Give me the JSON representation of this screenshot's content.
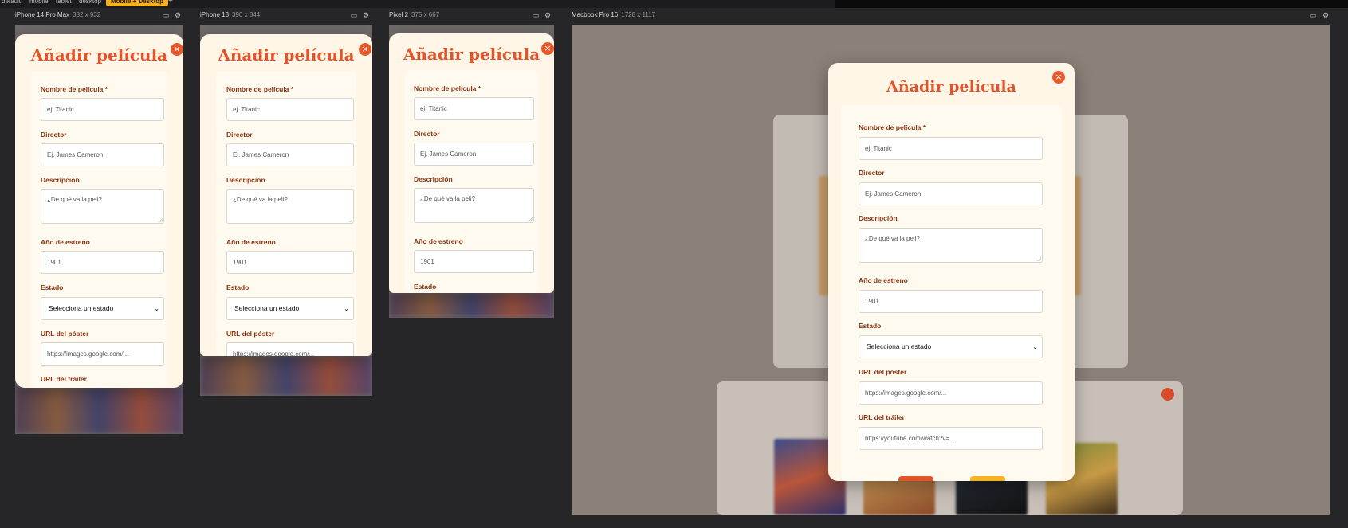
{
  "toolbar": {
    "tabs": [
      "default",
      "mobile",
      "tablet",
      "desktop",
      "Mobile + Desktop"
    ],
    "active_tab": "Mobile + Desktop",
    "add_icon": "+"
  },
  "devices": [
    {
      "name": "iPhone 14 Pro Max",
      "dims": "382 x 932"
    },
    {
      "name": "iPhone 13",
      "dims": "390 x 844"
    },
    {
      "name": "Pixel 2",
      "dims": "375 x 667"
    },
    {
      "name": "Macbook Pro 16",
      "dims": "1728 x 1117"
    }
  ],
  "header_icons": [
    "window-icon",
    "gear-icon"
  ],
  "modal": {
    "title": "Añadir película",
    "close": "×",
    "fields": {
      "name": {
        "label": "Nombre de película *",
        "placeholder": "ej. Titanic"
      },
      "director": {
        "label": "Director",
        "placeholder": "Ej. James Cameron"
      },
      "description": {
        "label": "Descripción",
        "placeholder": "¿De qué va la peli?"
      },
      "year": {
        "label": "Año de estreno",
        "value": "1901"
      },
      "status": {
        "label": "Estado",
        "value": "Selecciona un estado"
      },
      "poster": {
        "label": "URL del póster",
        "placeholder": "https://images.google.com/..."
      },
      "trailer": {
        "label": "URL del tráiler",
        "placeholder": "https://youtube.com/watch?v=..."
      }
    }
  },
  "colors": {
    "accent": "#e2552b",
    "label": "#8a3510",
    "modal_bg": "#fff6e7",
    "highlight": "#f4b223"
  }
}
